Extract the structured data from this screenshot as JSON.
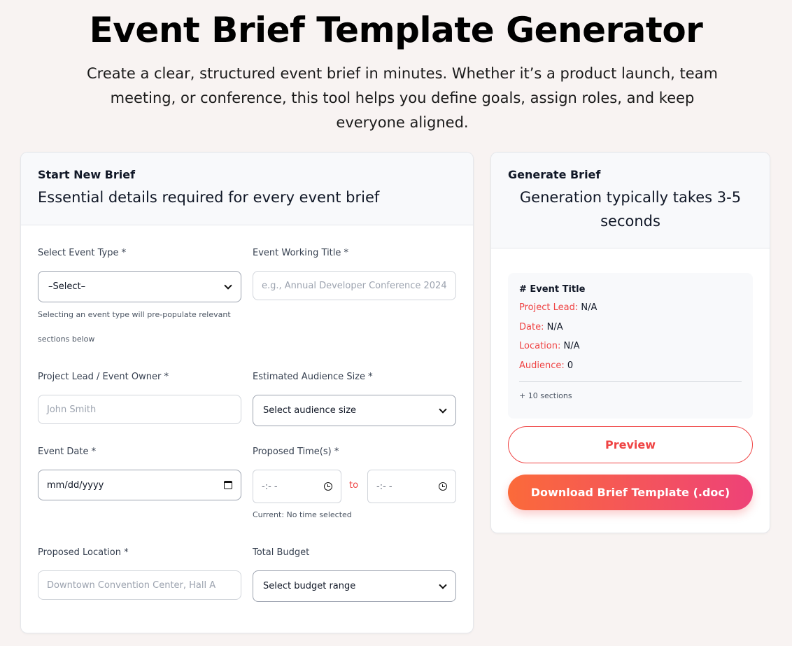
{
  "header": {
    "title": "Event Brief Template Generator",
    "subtitle": "Create a clear, structured event brief in minutes. Whether it’s a product launch, team meeting, or conference, this tool helps you define goals, assign roles, and keep everyone aligned."
  },
  "form": {
    "title": "Start New Brief",
    "description": "Essential details required for every event brief",
    "event_type": {
      "label": "Select Event Type *",
      "value": "–Select–",
      "help": "Selecting an event type will pre-populate relevant sections below"
    },
    "working_title": {
      "label": "Event Working Title *",
      "placeholder": "e.g., Annual Developer Conference 2024"
    },
    "project_lead": {
      "label": "Project Lead / Event Owner *",
      "placeholder": "John Smith"
    },
    "audience_size": {
      "label": "Estimated Audience Size *",
      "value": "Select audience size"
    },
    "event_date": {
      "label": "Event Date *",
      "value": "mm/dd/yyyy"
    },
    "proposed_times": {
      "label": "Proposed Time(s) *",
      "start": "-:- -",
      "separator": "to",
      "end": "-:- -",
      "current": "Current: No time selected"
    },
    "location": {
      "label": "Proposed Location *",
      "placeholder": "Downtown Convention Center, Hall A"
    },
    "budget": {
      "label": "Total Budget",
      "value": "Select budget range"
    }
  },
  "generate": {
    "title": "Generate Brief",
    "description": "Generation typically takes 3-5 seconds",
    "preview": {
      "heading": "# Event Title",
      "rows": [
        {
          "key": "Project Lead:",
          "value": "N/A"
        },
        {
          "key": "Date:",
          "value": "N/A"
        },
        {
          "key": "Location:",
          "value": "N/A"
        },
        {
          "key": "Audience:",
          "value": "0"
        }
      ],
      "more": "+ 10 sections"
    },
    "preview_button": "Preview",
    "download_button": "Download Brief Template (.doc)"
  }
}
